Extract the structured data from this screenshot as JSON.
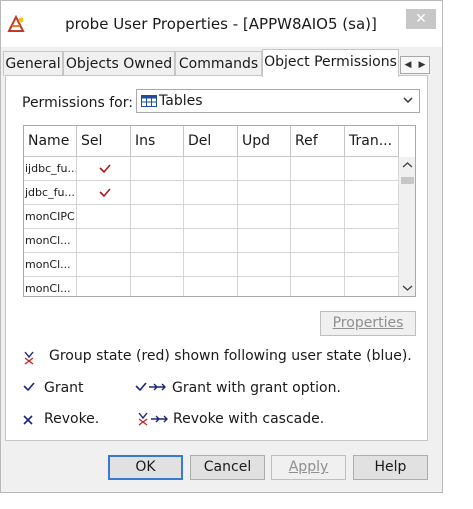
{
  "window": {
    "title": "probe User Properties - [APPW8AIO5 (sa)]",
    "close_glyph": "✕"
  },
  "tabs": [
    {
      "label": "General",
      "active": false
    },
    {
      "label": "Objects Owned",
      "active": false
    },
    {
      "label": "Commands",
      "active": false
    },
    {
      "label": "Object Permissions",
      "active": true
    }
  ],
  "tab_scroll": {
    "left": "◀",
    "right": "▶"
  },
  "permissions_for": {
    "label": "Permissions for:",
    "selected": "Tables",
    "icon": "table-icon"
  },
  "grid": {
    "columns": [
      "Name",
      "Sel",
      "Ins",
      "Del",
      "Upd",
      "Ref",
      "Tran..."
    ],
    "rows": [
      {
        "name": "ijdbc_fu...",
        "sel": true,
        "ins": false,
        "del": false,
        "upd": false,
        "ref": false,
        "tran": false
      },
      {
        "name": "jdbc_fu...",
        "sel": true,
        "ins": false,
        "del": false,
        "upd": false,
        "ref": false,
        "tran": false
      },
      {
        "name": "monCIPC",
        "sel": false,
        "ins": false,
        "del": false,
        "upd": false,
        "ref": false,
        "tran": false
      },
      {
        "name": "monCl...",
        "sel": false,
        "ins": false,
        "del": false,
        "upd": false,
        "ref": false,
        "tran": false
      },
      {
        "name": "monCl...",
        "sel": false,
        "ins": false,
        "del": false,
        "upd": false,
        "ref": false,
        "tran": false
      },
      {
        "name": "monCl...",
        "sel": false,
        "ins": false,
        "del": false,
        "upd": false,
        "ref": false,
        "tran": false
      }
    ]
  },
  "properties_button": "Properties",
  "legend": {
    "group_state": "Group state (red) shown following user state (blue).",
    "grant": "Grant",
    "grant_with_option": "Grant with grant option.",
    "revoke": "Revoke.",
    "revoke_cascade": "Revoke with cascade."
  },
  "buttons": {
    "ok": "OK",
    "cancel": "Cancel",
    "apply": "Apply",
    "help": "Help"
  },
  "colors": {
    "check_red": "#b01818",
    "legend_blue": "#1a237e",
    "legend_red": "#c62828",
    "accent": "#3a78d6"
  }
}
